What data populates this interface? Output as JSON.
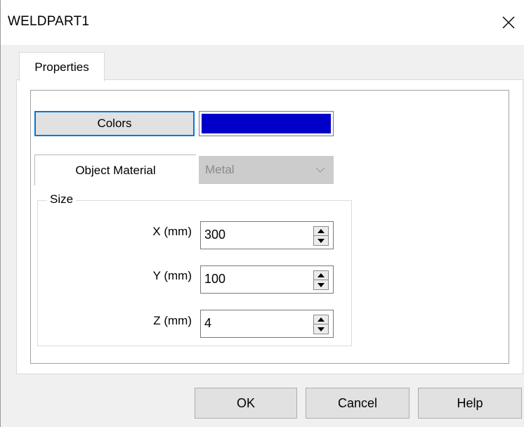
{
  "window": {
    "title": "WELDPART1",
    "close_icon": "close-icon"
  },
  "tabs": [
    {
      "label": "Properties",
      "active": true
    }
  ],
  "properties": {
    "colors_button": "Colors",
    "color_value": "#0000c8",
    "material_label": "Object Material",
    "material_value": "Metal",
    "material_enabled": false,
    "size_group": {
      "title": "Size",
      "fields": [
        {
          "label": "X (mm)",
          "value": "300"
        },
        {
          "label": "Y (mm)",
          "value": "100"
        },
        {
          "label": "Z (mm)",
          "value": "4"
        }
      ]
    }
  },
  "buttons": {
    "ok": "OK",
    "cancel": "Cancel",
    "help": "Help"
  },
  "colors": {
    "focus_border": "#0078d7",
    "dialog_bg": "#f0f0f0",
    "disabled_bg": "#cccccc"
  }
}
